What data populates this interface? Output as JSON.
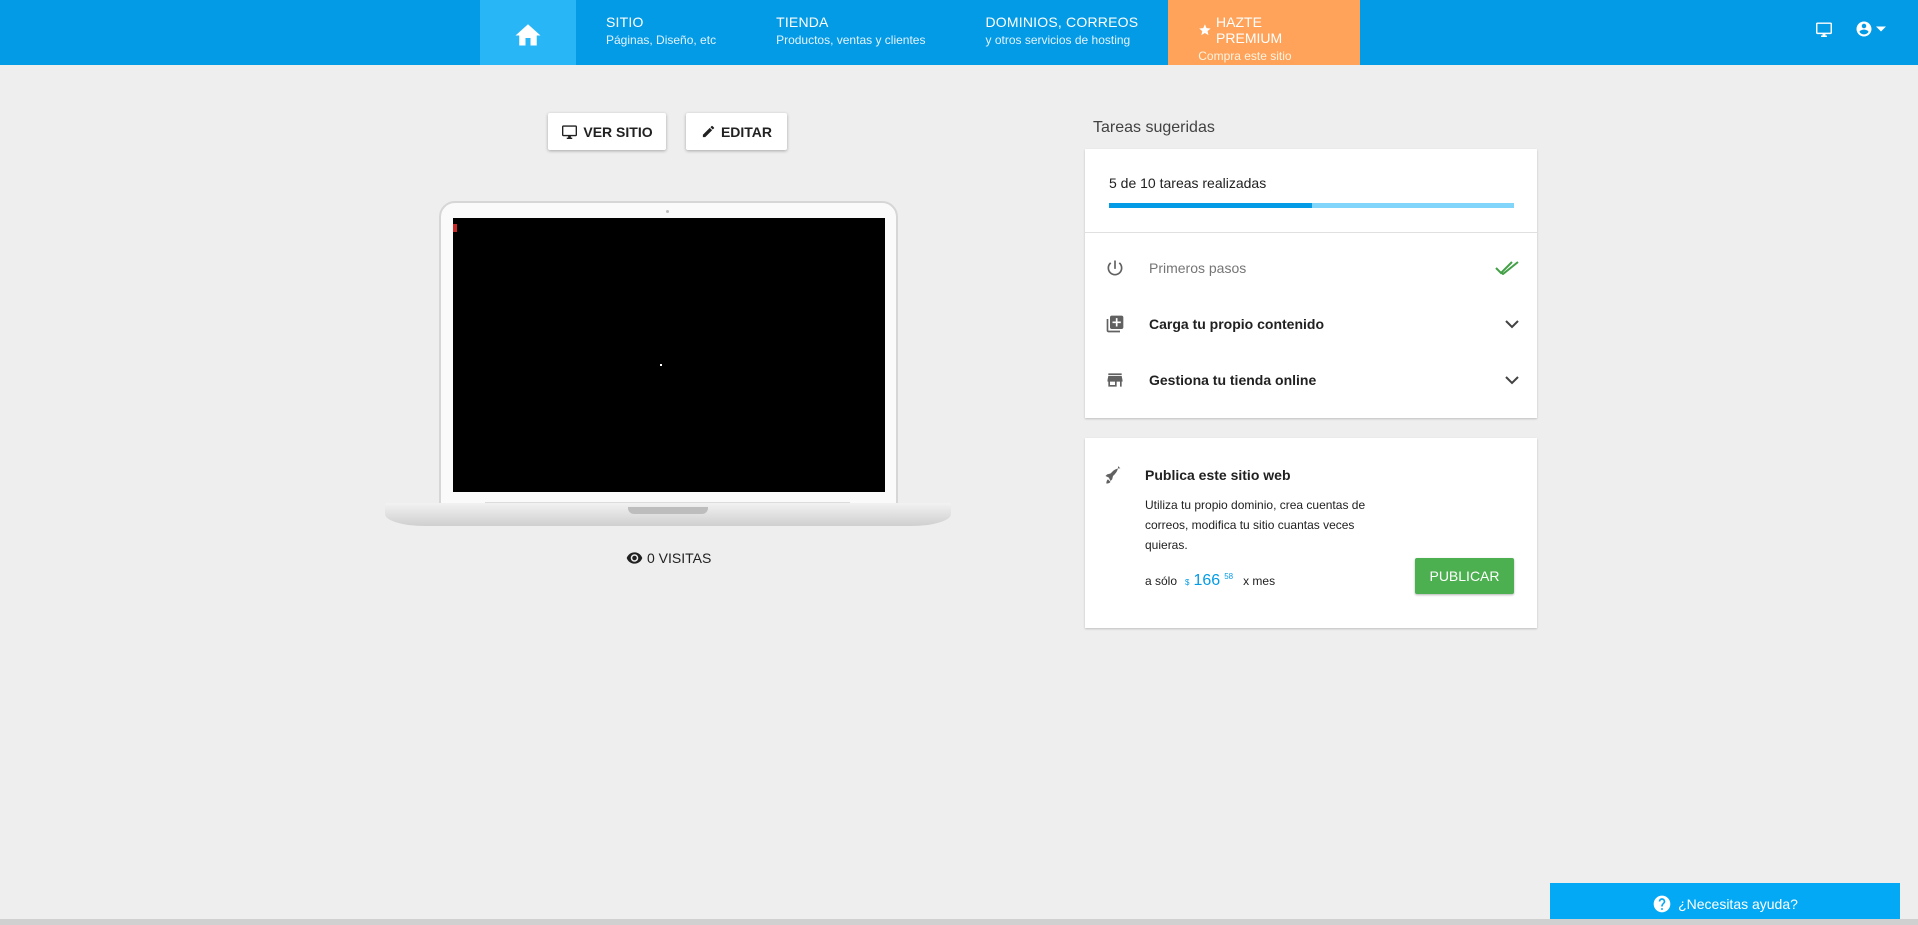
{
  "nav": {
    "home_icon": "home-icon",
    "items": [
      {
        "title": "SITIO",
        "subtitle": "Páginas, Diseño, etc"
      },
      {
        "title": "TIENDA",
        "subtitle": "Productos, ventas y clientes"
      },
      {
        "title": "DOMINIOS, CORREOS",
        "subtitle": "y otros servicios de hosting"
      }
    ],
    "premium": {
      "title": "HAZTE PREMIUM",
      "subtitle": "Compra este sitio"
    },
    "right_icons": [
      "desktop-icon",
      "account-icon",
      "dropdown-icon"
    ]
  },
  "preview": {
    "view_site_label": "VER SITIO",
    "edit_label": "EDITAR",
    "visits_label": "0 VISITAS"
  },
  "tasks": {
    "section_title": "Tareas sugeridas",
    "progress_text": "5 de 10 tareas realizadas",
    "progress_fraction": 0.5,
    "items": [
      {
        "label": "Primeros pasos",
        "icon": "power-icon",
        "done": true
      },
      {
        "label": "Carga tu propio contenido",
        "icon": "add-library-icon",
        "done": false
      },
      {
        "label": "Gestiona tu tienda online",
        "icon": "store-icon",
        "done": false
      }
    ]
  },
  "publish": {
    "title": "Publica este sitio web",
    "description": "Utiliza tu propio dominio, crea cuentas de correos, modifica tu sitio cuantas veces quieras.",
    "price_prefix": "a sólo",
    "currency": "$",
    "amount": "166",
    "cents": "58",
    "price_suffix": "x mes",
    "button_label": "PUBLICAR"
  },
  "help": {
    "label": "¿Necesitas ayuda?"
  },
  "colors": {
    "primary": "#039be5",
    "premium": "#ffa35a",
    "success": "#4caf50"
  }
}
